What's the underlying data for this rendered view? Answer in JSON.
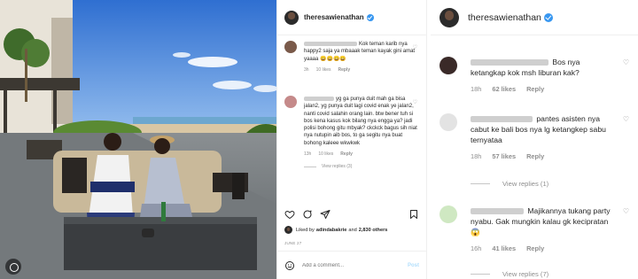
{
  "post": {
    "username": "theresawienathan",
    "comments": [
      {
        "name_hidden": true,
        "text": "Kok teman karib nya happy2 saja ya mbaaak teman kayak gini amat yaaaa 😄😄😄😄",
        "time": "3h",
        "likes": "10 likes",
        "reply": "Reply"
      },
      {
        "name_hidden": true,
        "text": "yg ga punya duit mah ga bisa jalan2, yg punya duit lagi covid enak ye jalan2, nanti covid salahin orang lain. btw bener tuh si bos kena kasus kok bilang nya engga ya? jadi polisi bohong gitu mbyak? ckckck bagus sih niat nya nutupin aib bos, to ga segitu nya buat bohong kaleee wkwkwk",
        "time": "13h",
        "likes": "10 likes",
        "reply": "Reply",
        "view_replies": "View replies (3)"
      }
    ],
    "liked_by_prefix": "Liked by",
    "liked_by_user": "adindabakrie",
    "liked_by_and": "and",
    "liked_by_others": "2,830 others",
    "date": "JUNE 27",
    "add_comment_placeholder": "Add a comment...",
    "post_label": "Post"
  },
  "panel": {
    "username": "theresawienathan",
    "comments": [
      {
        "text": "Bos nya ketangkap kok msh liburan kak?",
        "time": "18h",
        "likes": "62 likes",
        "reply": "Reply"
      },
      {
        "text": "pantes asisten nya cabut ke bali bos nya lg ketangkep sabu ternyataa",
        "time": "18h",
        "likes": "57 likes",
        "reply": "Reply",
        "view_replies": "View replies (1)"
      },
      {
        "text": "Majikannya tukang party nyabu. Gak mungkin kalau gk kecipratan 😱",
        "time": "16h",
        "likes": "41 likes",
        "reply": "Reply",
        "view_replies": "View replies (7)"
      }
    ]
  },
  "icons": {
    "heart": "heart-icon",
    "comment": "comment-icon",
    "share": "share-icon",
    "save": "bookmark-icon",
    "emoji": "emoji-icon",
    "verified": "verified-badge-icon"
  },
  "colors": {
    "verified": "#3897f0",
    "muted": "#8e8e8e",
    "post_button": "#b2dffc"
  }
}
